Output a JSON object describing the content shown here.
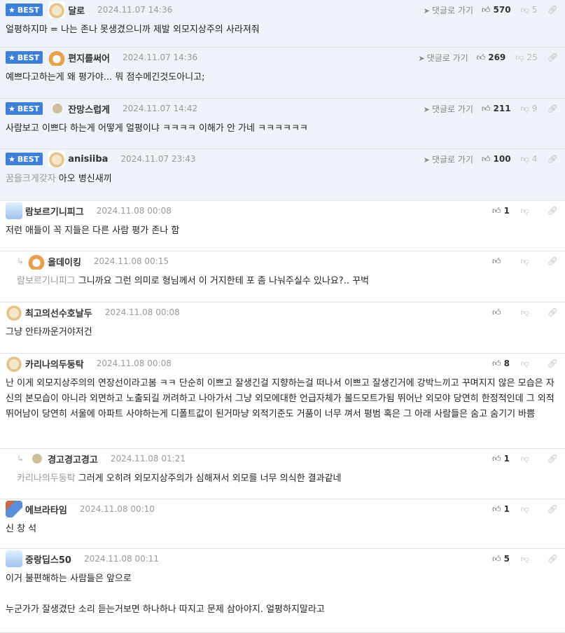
{
  "comments": [
    {
      "best": true,
      "badge": "BEST",
      "nick": "달로",
      "date": "2024.11.07 14:36",
      "goto": "댓글로 가기",
      "up": "570",
      "down": "5",
      "avatar": "dog",
      "body": [
        "얼평하지마 = 나는 존나 못생겼으니까 제발 외모지상주의 사라져줘"
      ]
    },
    {
      "best": true,
      "badge": "BEST",
      "nick": "편지를써어",
      "date": "2024.11.07 14:36",
      "goto": "댓글로 가기",
      "up": "269",
      "down": "25",
      "avatar": "fox",
      "body": [
        "예쁘다고하는게 왜 평가야... 뭐 점수메긴것도아니고;"
      ]
    },
    {
      "best": true,
      "badge": "BEST",
      "nick": "잔망스럽게",
      "date": "2024.11.07 14:42",
      "goto": "댓글로 가기",
      "up": "211",
      "down": "9",
      "avatar": "dot",
      "body": [
        "사람보고 이쁘다 하는게 어떻게 얼평이냐 ㅋㅋㅋㅋ 이해가 안 가네 ㅋㅋㅋㅋㅋㅋ"
      ]
    },
    {
      "best": true,
      "badge": "BEST",
      "nick": "anisiiba",
      "date": "2024.11.07 23:43",
      "goto": "댓글로 가기",
      "up": "100",
      "down": "4",
      "avatar": "dog",
      "tag": "꿈을크게갖자",
      "body": [
        "아오 병신새끼"
      ]
    },
    {
      "best": false,
      "nick": "람보르기니피그",
      "date": "2024.11.08 00:08",
      "up": "1",
      "down": "",
      "avatar": "rabbit",
      "body": [
        "저런 애들이 꼭 지들은 다른 사람 평가 존나 함"
      ]
    },
    {
      "best": false,
      "reply": true,
      "nick": "올데이킹",
      "date": "2024.11.08 00:15",
      "up": "",
      "down": "",
      "avatar": "fox",
      "tag": "람보르기니피그",
      "body": [
        "그니까요 그런 의미로 형님께서 이 거지한테 포 좀 나눠주실수 있나요?.. 꾸벅"
      ]
    },
    {
      "best": false,
      "nick": "최고의선수호날두",
      "date": "2024.11.08 00:08",
      "up": "",
      "down": "",
      "avatar": "dog",
      "body": [
        "그냥 안타까운거야저건"
      ]
    },
    {
      "best": false,
      "nick": "카리나의두둥탁",
      "date": "2024.11.08 00:08",
      "up": "8",
      "down": "",
      "avatar": "dog",
      "body": [
        "난 이게 외모지상주의의 연장선이라고봄 ㅋㅋ 단순히 이쁘고 잘생긴걸 지향하는걸 떠나서 이쁘고 잘생긴거에 강박느끼고 꾸며지지 않은 모습은 자신의 본모습이 아니라 외면하고 노출되길 꺼려하고 나아가서 그냥 외모에대한 언급자체가 볼드모트가됨 뛰어난 외모야 당연히 한정적인데 그 외적 뛰어남이 당연히 서울에 아파트 사야하는게 디폴트값이 된거마냥 외적기준도 거품이 너무 껴서 평범 혹은 그 아래 사람들은 숨고 숨기기 바쁨"
      ]
    },
    {
      "best": false,
      "reply": true,
      "nick": "경고경고경고",
      "date": "2024.11.08 01:21",
      "up": "1",
      "down": "",
      "avatar": "dot",
      "tag": "카리나의두둥탁",
      "body": [
        "그러게 오히려 외모지상주의가 심해져서 외모를 너무 의식한 결과같네"
      ]
    },
    {
      "best": false,
      "nick": "에브라타임",
      "date": "2024.11.08 00:10",
      "up": "1",
      "down": "",
      "avatar": "flag",
      "body": [
        "신 창 석"
      ]
    },
    {
      "best": false,
      "nick": "중랑딥스50",
      "date": "2024.11.08 00:11",
      "up": "5",
      "down": "",
      "avatar": "rabbit",
      "body": [
        "이거 불편해하는 사람들은 앞으로",
        "",
        "누군가가 잘생겼단 소리 듣는거보면 하나하나 따지고 문제 삼아야지. 얼평하지말라고"
      ]
    }
  ]
}
